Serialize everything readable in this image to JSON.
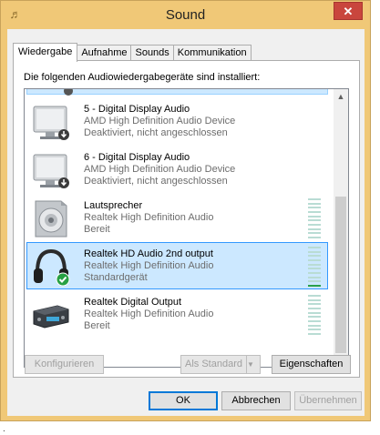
{
  "window": {
    "title": "Sound",
    "close_label": "✕"
  },
  "tabs": [
    {
      "label": "Wiedergabe",
      "active": true
    },
    {
      "label": "Aufnahme",
      "active": false
    },
    {
      "label": "Sounds",
      "active": false
    },
    {
      "label": "Kommunikation",
      "active": false
    }
  ],
  "panel": {
    "label": "Die folgenden Audiowiedergabegeräte sind installiert:"
  },
  "devices": [
    {
      "name": "5 - Digital Display Audio",
      "driver": "AMD High Definition Audio Device",
      "status": "Deaktiviert, nicht angeschlossen",
      "icon": "monitor-icon",
      "selected": false,
      "level": 0
    },
    {
      "name": "6 - Digital Display Audio",
      "driver": "AMD High Definition Audio Device",
      "status": "Deaktiviert, nicht angeschlossen",
      "icon": "monitor-icon",
      "selected": false,
      "level": 0
    },
    {
      "name": "Lautsprecher",
      "driver": "Realtek High Definition Audio",
      "status": "Bereit",
      "icon": "speaker-icon",
      "selected": false,
      "level": 0
    },
    {
      "name": "Realtek HD Audio 2nd output",
      "driver": "Realtek High Definition Audio",
      "status": "Standardgerät",
      "icon": "headphones-icon",
      "selected": true,
      "level": 0.1
    },
    {
      "name": "Realtek Digital Output",
      "driver": "Realtek High Definition Audio",
      "status": "Bereit",
      "icon": "digital-output-icon",
      "selected": false,
      "level": 0
    }
  ],
  "buttons": {
    "configure": "Konfigurieren",
    "set_default": "Als Standard",
    "properties": "Eigenschaften",
    "ok": "OK",
    "cancel": "Abbrechen",
    "apply": "Übernehmen"
  },
  "colors": {
    "titlebar": "#f0c877",
    "selection": "#cce8ff",
    "level_on": "#2aa04a",
    "close": "#c9463d"
  }
}
